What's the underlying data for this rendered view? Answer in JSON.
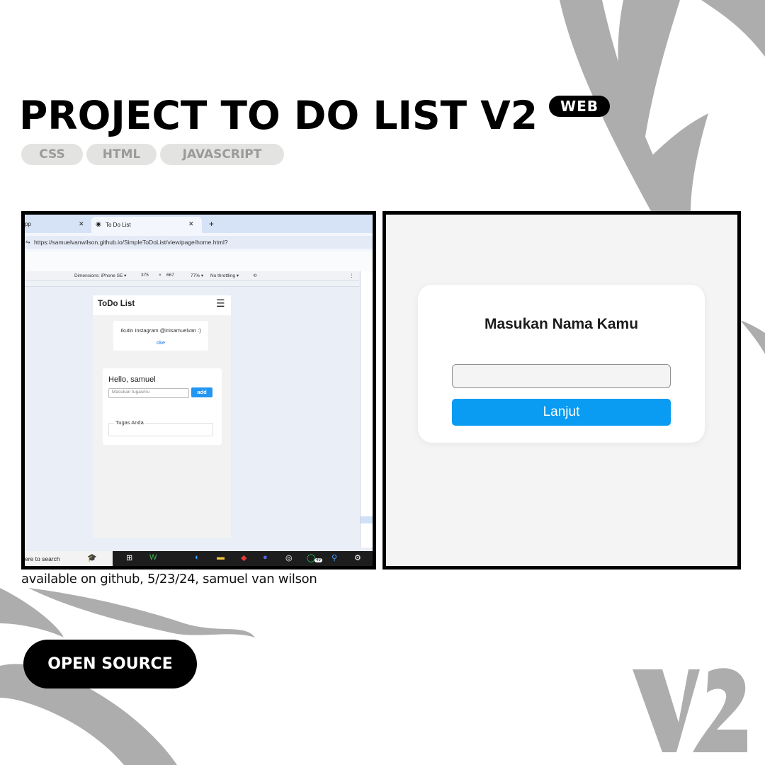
{
  "header": {
    "title": "PROJECT TO DO LIST V2",
    "badge": "WEB"
  },
  "tags": [
    "CSS",
    "HTML",
    "JAVASCRIPT"
  ],
  "screenshot_left": {
    "tab1_label": "pp",
    "tab2_label": "To Do List",
    "url": "https://samuelvanwilson.github.io/SimpleToDoList/view/page/home.html?",
    "device_toolbar": {
      "dimensions": "Dimensions: iPhone SE ▾",
      "width": "375",
      "times": "×",
      "height": "667",
      "zoom": "77% ▾",
      "throttling": "No throttling ▾"
    },
    "app": {
      "title": "ToDo List",
      "popup_message": "Ikutin Instagram @inisamuelvan :)",
      "popup_button": "oke",
      "greeting": "Hello, samuel",
      "input_placeholder": "Masukan tugasmu",
      "add_button": "add",
      "tasks_label": "Tugas Anda"
    },
    "taskbar": {
      "search_text": "ere to search",
      "notification_count": "49"
    }
  },
  "screenshot_right": {
    "title": "Masukan Nama Kamu",
    "input_value": "",
    "button_label": "Lanjut"
  },
  "caption": "available on github, 5/23/24, samuel van wilson",
  "cta": "OPEN SOURCE",
  "watermark": "V2",
  "colors": {
    "accent_blue": "#0a9bf2",
    "tag_bg": "#e3e3e1",
    "tag_text": "#9a9a9a",
    "decor_gray": "#adadad"
  }
}
